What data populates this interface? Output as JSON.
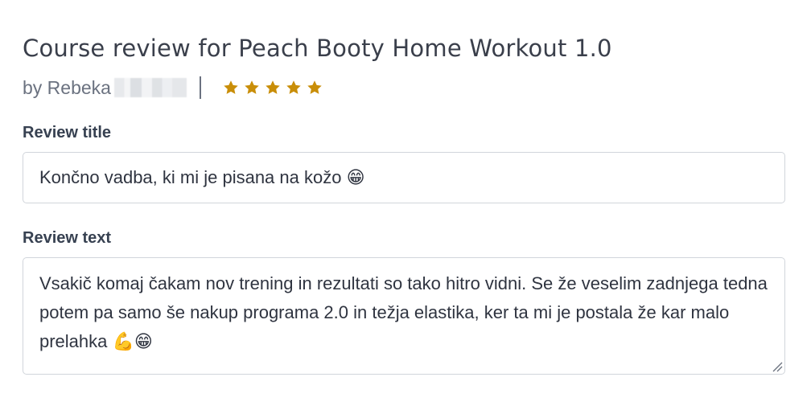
{
  "review": {
    "heading": "Course review for Peach Booty Home Workout 1.0",
    "author_label": "by Rebeka",
    "rating": 5,
    "rating_max": 5,
    "star_color": "#c98e09"
  },
  "title_field": {
    "label": "Review title",
    "value": "Končno vadba, ki mi je pisana na kožo 😁"
  },
  "text_field": {
    "label": "Review text",
    "value": "Vsakič komaj čakam nov trening in rezultati so tako hitro vidni. Se že veselim zadnjega tedna potem pa samo še nakup programa 2.0 in težja elastika, ker ta mi je postala že kar malo prelahka 💪😁"
  }
}
